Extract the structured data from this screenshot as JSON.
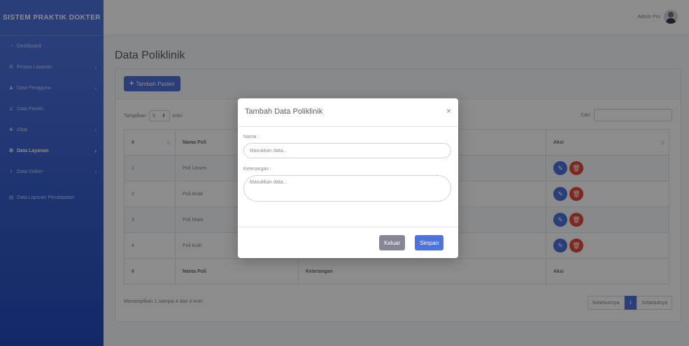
{
  "sidebar": {
    "brand": "SISTEM PRAKTIK DOKTER",
    "items": [
      {
        "label": "Dashboard",
        "icon": "dashboard-icon",
        "chevron": false
      },
      {
        "label": "Proses Layanan",
        "icon": "process-icon",
        "chevron": true
      },
      {
        "label": "Data Pengguna",
        "icon": "users-icon",
        "chevron": true
      },
      {
        "label": "Data Pasien",
        "icon": "patient-icon",
        "chevron": false
      },
      {
        "label": "Obat",
        "icon": "medicine-icon",
        "chevron": true
      },
      {
        "label": "Data Layanan",
        "icon": "gear-icon",
        "chevron": true,
        "active": true
      },
      {
        "label": "Data Dokter",
        "icon": "doctor-icon",
        "chevron": true
      },
      {
        "label": "Data Laporan Pendapatan",
        "icon": "report-icon",
        "chevron": false
      }
    ]
  },
  "topbar": {
    "user_name": "Admin Pro"
  },
  "main": {
    "title": "Data Poliklinik",
    "add_button": "Tambah Pasien",
    "length_label_pre": "Tampilkan",
    "length_value": "5",
    "length_label_post": "entri",
    "search_label": "Cari:",
    "columns": [
      "#",
      "Nama Poli",
      "Keterangan",
      "Aksi"
    ],
    "rows": [
      {
        "no": "1",
        "nama": "Poli Umum",
        "ket": ""
      },
      {
        "no": "2",
        "nama": "Poli Anak",
        "ket": ""
      },
      {
        "no": "3",
        "nama": "Poli Mata",
        "ket": ""
      },
      {
        "no": "4",
        "nama": "Poli Kulit",
        "ket": ""
      }
    ],
    "info": "Menampilkan 1 sampai 4 dari 4 entri",
    "pager": {
      "prev": "Sebelumnya",
      "current": "1",
      "next": "Selanjutnya"
    }
  },
  "footer": "",
  "modal": {
    "title": "Tambah Data Poliklinik",
    "close": "×",
    "nama_label": "Nama :",
    "nama_placeholder": "Masukkan data...",
    "ket_label": "Keterangan :",
    "ket_placeholder": "Masukkan data...",
    "btn_keluar": "Keluar",
    "btn_simpan": "Simpan"
  },
  "colors": {
    "primary": "#4e73df",
    "danger": "#e74a3b",
    "secondary": "#858796"
  }
}
